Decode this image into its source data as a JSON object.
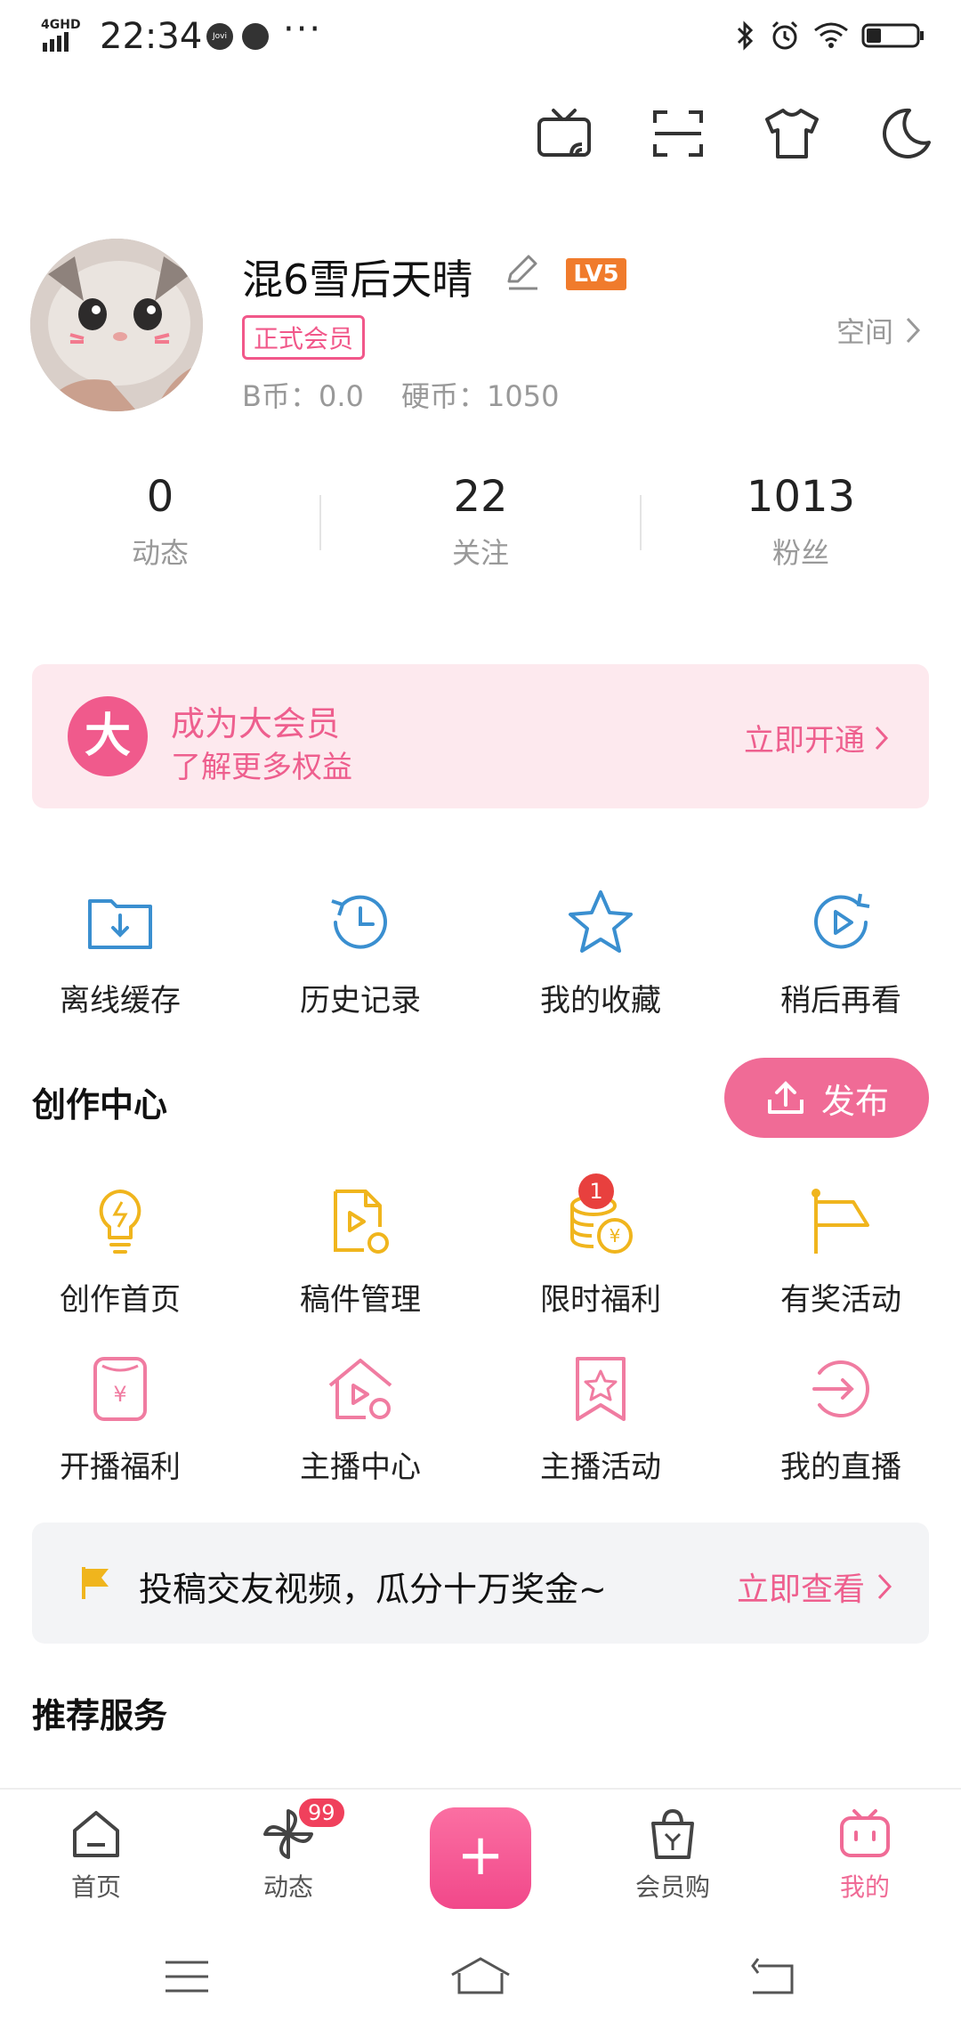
{
  "status_bar": {
    "network": "4GHD",
    "time": "22:34",
    "app_icon_1": "Jovi",
    "more": "···",
    "battery_level": 0.3
  },
  "top_icons": [
    "tv-cast-icon",
    "scan-icon",
    "shirt-icon",
    "moon-icon"
  ],
  "profile": {
    "username": "混6雪后天晴",
    "level": "LV5",
    "member_badge": "正式会员",
    "coins_text": "B币：0.0　 硬币：1050",
    "space_label": "空间"
  },
  "stats": [
    {
      "value": "0",
      "label": "动态"
    },
    {
      "value": "22",
      "label": "关注"
    },
    {
      "value": "1013",
      "label": "粉丝"
    }
  ],
  "vip_banner": {
    "icon_char": "大",
    "title": "成为大会员",
    "subtitle": "了解更多权益",
    "action": "立即开通"
  },
  "quick_actions": [
    {
      "label": "离线缓存",
      "icon": "offline-folder-icon"
    },
    {
      "label": "历史记录",
      "icon": "history-clock-icon"
    },
    {
      "label": "我的收藏",
      "icon": "star-icon"
    },
    {
      "label": "稍后再看",
      "icon": "watch-later-icon"
    }
  ],
  "creation_center": {
    "title": "创作中心",
    "publish_label": "发布",
    "items": [
      {
        "label": "创作首页",
        "icon": "lightbulb-icon"
      },
      {
        "label": "稿件管理",
        "icon": "manuscript-icon"
      },
      {
        "label": "限时福利",
        "icon": "coins-icon",
        "badge": "1"
      },
      {
        "label": "有奖活动",
        "icon": "flag-icon"
      },
      {
        "label": "开播福利",
        "icon": "live-welfare-icon"
      },
      {
        "label": "主播中心",
        "icon": "streamer-home-icon"
      },
      {
        "label": "主播活动",
        "icon": "bookmark-star-icon"
      },
      {
        "label": "我的直播",
        "icon": "enter-icon"
      }
    ]
  },
  "promo": {
    "text": "投稿交友视频，瓜分十万奖金~",
    "action": "立即查看"
  },
  "recommended": {
    "title": "推荐服务"
  },
  "bottom_nav": [
    {
      "label": "首页",
      "icon": "home-icon"
    },
    {
      "label": "动态",
      "icon": "pinwheel-icon",
      "badge": "99"
    },
    {
      "label": "",
      "icon": "plus-icon"
    },
    {
      "label": "会员购",
      "icon": "shopping-bag-icon"
    },
    {
      "label": "我的",
      "icon": "bilibili-tv-icon",
      "active": true
    }
  ],
  "colors": {
    "accent": "#f06b96",
    "pink_text": "#ee5f8e",
    "gold": "#f0b51d",
    "blue": "#3a8fd0",
    "pink_icon": "#f07ca1"
  }
}
